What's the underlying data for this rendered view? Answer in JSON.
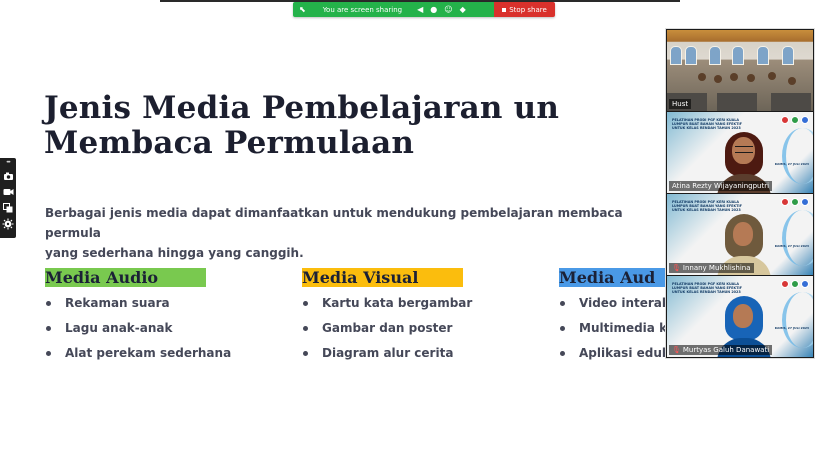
{
  "screen_share_bar": {
    "status_text": "You are screen sharing",
    "stop_label": "Stop share",
    "colors": {
      "bar": "#24b24a",
      "stop": "#d9312c"
    },
    "icons": [
      "arrow-icon",
      "speaker-icon",
      "microphone-icon",
      "emoji-icon",
      "shield-icon",
      "stop-square-icon"
    ]
  },
  "left_toolbar": {
    "icons": [
      "drag-handle-icon",
      "camera-icon",
      "video-camera-icon",
      "layout-icon",
      "settings-icon"
    ]
  },
  "slide": {
    "title": {
      "line1": "Jenis Media Pembelajaran un",
      "line2": "Membaca Permulaan"
    },
    "intro": {
      "line1": "Berbagai jenis media dapat dimanfaatkan untuk mendukung pembelajaran membaca permula",
      "line2": "yang sederhana hingga yang canggih."
    },
    "categories": [
      {
        "heading": "Media Audio",
        "items": [
          "Rekaman suara",
          "Lagu anak-anak",
          "Alat perekam sederhana"
        ]
      },
      {
        "heading": "Media Visual",
        "items": [
          "Kartu kata bergambar",
          "Gambar dan poster",
          "Diagram alur cerita"
        ]
      },
      {
        "heading": "Media Aud",
        "items": [
          "Video interak",
          "Multimedia k",
          "Aplikasi edukasi"
        ]
      }
    ],
    "colors": {
      "audio": "#79c94f",
      "visual": "#fbbd0d",
      "audio_visual": "#4a99e6",
      "text": "#454858",
      "title": "#1c1f2f"
    }
  },
  "participants": {
    "host_label": "Hust",
    "tiles": [
      {
        "name": "Atina Rezty Wijayaningputri",
        "banner_text": "PELATIHAN PRODI PGF KERI KUALA LUMPUR BUAT BAHAN YANG EFEKTIF UNTUK KELAS RENDAH TAHUN 2023",
        "banner_date": "KAMIS, 27 JULI 2023"
      },
      {
        "name": "Innany Mukhlishina",
        "banner_text": "PELATIHAN PRODI PGF KERI KUALA LUMPUR BUAT BAHAN YANG EFEKTIF UNTUK KELAS RENDAH TAHUN 2023",
        "banner_date": "KAMIS, 27 JULI 2023"
      },
      {
        "name": "Murtyas Galuh Danawati",
        "banner_text": "PELATIHAN PRODI PGF KERI KUALA LUMPUR BUAT BAHAN YANG EFEKTIF UNTUK KELAS RENDAH TAHUN 2023",
        "banner_date": "KAMIS, 27 JULI 2023"
      }
    ]
  }
}
